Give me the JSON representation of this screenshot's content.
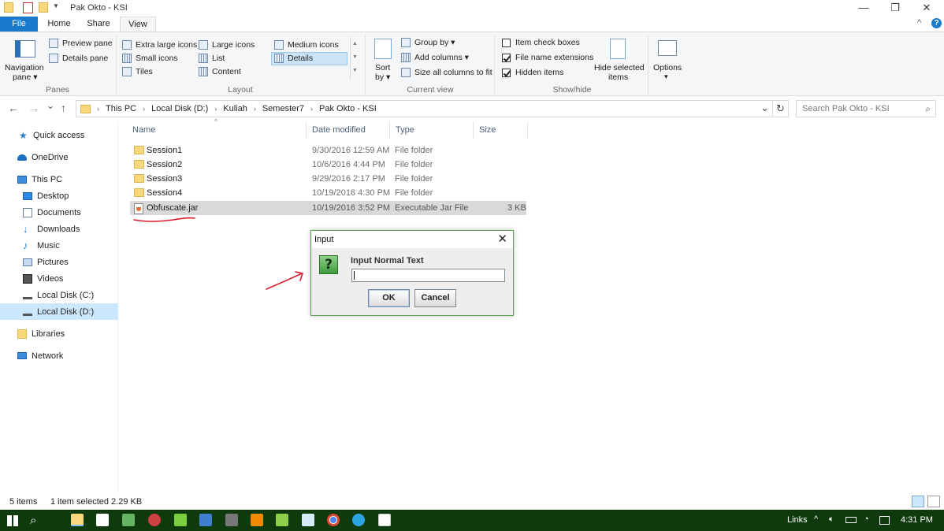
{
  "window": {
    "title": "Pak Okto - KSI",
    "minimize_glyph": "—",
    "restore_glyph": "❐",
    "close_glyph": "✕",
    "collapse_glyph": "^",
    "help_glyph": "?"
  },
  "tabs": [
    {
      "label": "File"
    },
    {
      "label": "Home"
    },
    {
      "label": "Share"
    },
    {
      "label": "View"
    }
  ],
  "ribbon": {
    "panes": {
      "navigation_pane": "Navigation",
      "navigation_pane_2": "pane ▾",
      "preview_pane": "Preview pane",
      "details_pane": "Details pane",
      "group_label": "Panes"
    },
    "layout": {
      "items": [
        "Extra large icons",
        "Large icons",
        "Medium icons",
        "Small icons",
        "List",
        "Details",
        "Tiles",
        "Content"
      ],
      "group_label": "Layout"
    },
    "current_view": {
      "sort_by": "Sort",
      "sort_by_2": "by ▾",
      "group_by": "Group by ▾",
      "add_columns": "Add columns ▾",
      "size_all_columns": "Size all columns to fit",
      "group_label": "Current view"
    },
    "show_hide": {
      "item_check_boxes": "Item check boxes",
      "file_name_extensions": "File name extensions",
      "hidden_items": "Hidden items",
      "hide_selected": "Hide selected",
      "hide_selected_2": "items",
      "group_label": "Show/hide"
    },
    "options": {
      "label": "Options",
      "arrow": "▾"
    }
  },
  "nav": {
    "back": "←",
    "forward": "→",
    "recent": "⌄",
    "up": "↑",
    "breadcrumbs": [
      "This PC",
      "Local Disk (D:)",
      "Kuliah",
      "Semester7",
      "Pak Okto - KSI"
    ],
    "crumb_sep": "›",
    "dropdown": "⌄",
    "refresh": "↻",
    "search_placeholder": "Search Pak Okto - KSI",
    "search_icon": "⌕"
  },
  "sidebar": {
    "items": [
      {
        "label": "Quick access"
      },
      {
        "label": "OneDrive"
      },
      {
        "label": "This PC"
      },
      {
        "label": "Desktop"
      },
      {
        "label": "Documents"
      },
      {
        "label": "Downloads"
      },
      {
        "label": "Music"
      },
      {
        "label": "Pictures"
      },
      {
        "label": "Videos"
      },
      {
        "label": "Local Disk (C:)"
      },
      {
        "label": "Local Disk (D:)"
      },
      {
        "label": "Libraries"
      },
      {
        "label": "Network"
      }
    ]
  },
  "columns": {
    "name": "Name",
    "date_modified": "Date modified",
    "type": "Type",
    "size": "Size",
    "sort_glyph": "^"
  },
  "files": [
    {
      "name": "Session1",
      "date": "9/30/2016 12:59 AM",
      "type": "File folder",
      "size": ""
    },
    {
      "name": "Session2",
      "date": "10/6/2016 4:44 PM",
      "type": "File folder",
      "size": ""
    },
    {
      "name": "Session3",
      "date": "9/29/2016 2:17 PM",
      "type": "File folder",
      "size": ""
    },
    {
      "name": "Session4",
      "date": "10/19/2016 4:30 PM",
      "type": "File folder",
      "size": ""
    },
    {
      "name": "Obfuscate.jar",
      "date": "10/19/2016 3:52 PM",
      "type": "Executable Jar File",
      "size": "3 KB"
    }
  ],
  "dialog": {
    "title": "Input",
    "close_glyph": "✕",
    "icon_glyph": "?",
    "prompt": "Input Normal Text",
    "value": "",
    "ok": "OK",
    "cancel": "Cancel"
  },
  "status": {
    "count": "5 items",
    "selection": "1 item selected  2.29 KB"
  },
  "taskbar": {
    "links": "Links",
    "tray_arrow": "^",
    "time": "4:31 PM"
  },
  "colors": {
    "accent": "#1979ca",
    "selection": "#cce8ff",
    "taskbar": "#0f3a0d",
    "annotation": "#e0182b"
  }
}
